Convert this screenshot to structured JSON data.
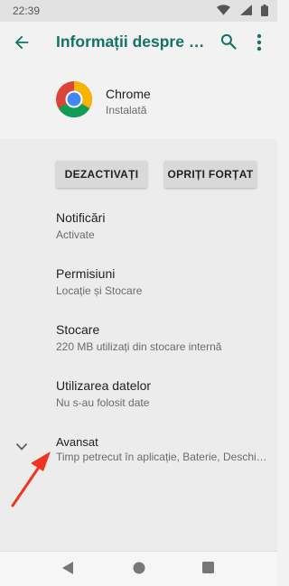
{
  "status_bar": {
    "time": "22:39"
  },
  "app_bar": {
    "title": "Informații despre aplicație"
  },
  "app_header": {
    "name": "Chrome",
    "state": "Instalată"
  },
  "actions": {
    "disable_label": "DEZACTIVAȚI",
    "force_stop_label": "OPRIȚI FORȚAT"
  },
  "settings": [
    {
      "title": "Notificări",
      "subtitle": "Activate"
    },
    {
      "title": "Permisiuni",
      "subtitle": "Locație și Stocare"
    },
    {
      "title": "Stocare",
      "subtitle": "220 MB utilizați din stocare internă"
    },
    {
      "title": "Utilizarea datelor",
      "subtitle": "Nu s-au folosit date"
    },
    {
      "title": "Avansat",
      "subtitle": "Timp petrecut în aplicație, Baterie, Deschide în mod prestabilit"
    }
  ],
  "colors": {
    "accent": "#137367",
    "annotation_arrow": "#f0341e",
    "surface": "#ececec",
    "header": "#f2f2f2"
  }
}
